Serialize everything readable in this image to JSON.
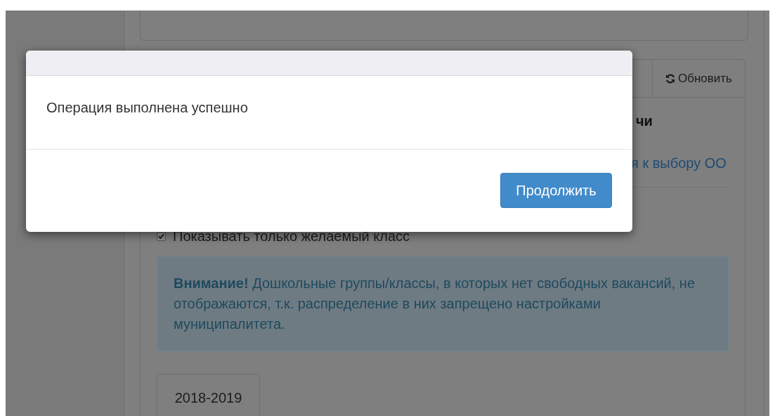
{
  "background": {
    "refresh_button": "Обновить",
    "heading_fragment": "чи",
    "link_fragment": "я к выбору ОО",
    "checkbox": {
      "label": "Показывать только желаемый класс",
      "checked": true
    },
    "alert": {
      "text": "**Внимание!** Дошкольные группы/классы, в которых нет свободных вакансий, не отображаются, т.к. распределение в них запрещено настройками муниципалитета."
    },
    "tabs": [
      {
        "label": "2018-2019",
        "selected": true
      }
    ]
  },
  "modal": {
    "message": "Операция выполнена успешно",
    "button": "Продолжить"
  }
}
